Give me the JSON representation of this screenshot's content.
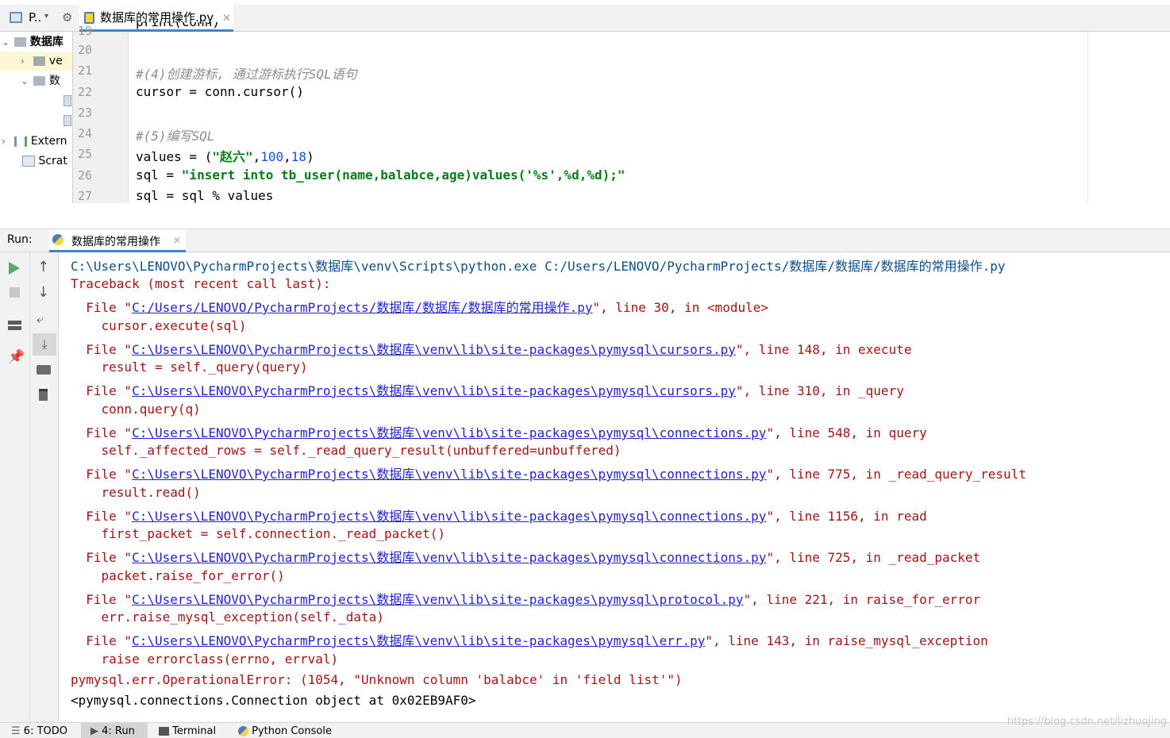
{
  "project": {
    "title": "P..",
    "tree": [
      {
        "label": "数据库",
        "level": 0
      },
      {
        "label": "ve",
        "level": 1
      },
      {
        "label": "数",
        "level": 1
      },
      {
        "label": "",
        "level": 2
      },
      {
        "label": "",
        "level": 2
      },
      {
        "label": "Extern",
        "level": 0
      },
      {
        "label": "Scrat",
        "level": 0
      }
    ]
  },
  "editor": {
    "tab_label": "数据库的常用操作.py",
    "line_numbers": [
      "19",
      "20",
      "21",
      "22",
      "23",
      "24",
      "25",
      "26",
      "27"
    ],
    "lines": {
      "l19": "print(conn)",
      "l21": "#(4)创建游标, 通过游标执行SQL语句",
      "l22": "cursor = conn.cursor()",
      "l24": "#(5)编写SQL",
      "l25_a": "values = (",
      "l25_s": "\"赵六\"",
      "l25_b": ",",
      "l25_n1": "100",
      "l25_c": ",",
      "l25_n2": "18",
      "l25_d": ")",
      "l26_a": "sql = ",
      "l26_s": "\"insert into tb_user(name,balabce,age)values('%s',%d,%d);\"",
      "l27": "sql = sql % values"
    }
  },
  "run": {
    "label": "Run:",
    "tab_label": "数据库的常用操作",
    "console": {
      "cmd": "C:\\Users\\LENOVO\\PycharmProjects\\数据库\\venv\\Scripts\\python.exe C:/Users/LENOVO/PycharmProjects/数据库/数据库/数据库的常用操作.py",
      "traceback": "Traceback (most recent call last):",
      "frames": [
        {
          "prefix": "  File \"",
          "link": "C:/Users/LENOVO/PycharmProjects/数据库/数据库/数据库的常用操作.py",
          "suffix": "\", line 30, in <module>",
          "code": "    cursor.execute(sql)"
        },
        {
          "prefix": "  File \"",
          "link": "C:\\Users\\LENOVO\\PycharmProjects\\数据库\\venv\\lib\\site-packages\\pymysql\\cursors.py",
          "suffix": "\", line 148, in execute",
          "code": "    result = self._query(query)"
        },
        {
          "prefix": "  File \"",
          "link": "C:\\Users\\LENOVO\\PycharmProjects\\数据库\\venv\\lib\\site-packages\\pymysql\\cursors.py",
          "suffix": "\", line 310, in _query",
          "code": "    conn.query(q)"
        },
        {
          "prefix": "  File \"",
          "link": "C:\\Users\\LENOVO\\PycharmProjects\\数据库\\venv\\lib\\site-packages\\pymysql\\connections.py",
          "suffix": "\", line 548, in query",
          "code": "    self._affected_rows = self._read_query_result(unbuffered=unbuffered)"
        },
        {
          "prefix": "  File \"",
          "link": "C:\\Users\\LENOVO\\PycharmProjects\\数据库\\venv\\lib\\site-packages\\pymysql\\connections.py",
          "suffix": "\", line 775, in _read_query_result",
          "code": "    result.read()"
        },
        {
          "prefix": "  File \"",
          "link": "C:\\Users\\LENOVO\\PycharmProjects\\数据库\\venv\\lib\\site-packages\\pymysql\\connections.py",
          "suffix": "\", line 1156, in read",
          "code": "    first_packet = self.connection._read_packet()"
        },
        {
          "prefix": "  File \"",
          "link": "C:\\Users\\LENOVO\\PycharmProjects\\数据库\\venv\\lib\\site-packages\\pymysql\\connections.py",
          "suffix": "\", line 725, in _read_packet",
          "code": "    packet.raise_for_error()"
        },
        {
          "prefix": "  File \"",
          "link": "C:\\Users\\LENOVO\\PycharmProjects\\数据库\\venv\\lib\\site-packages\\pymysql\\protocol.py",
          "suffix": "\", line 221, in raise_for_error",
          "code": "    err.raise_mysql_exception(self._data)"
        },
        {
          "prefix": "  File \"",
          "link": "C:\\Users\\LENOVO\\PycharmProjects\\数据库\\venv\\lib\\site-packages\\pymysql\\err.py",
          "suffix": "\", line 143, in raise_mysql_exception",
          "code": "    raise errorclass(errno, errval)"
        }
      ],
      "error": "pymysql.err.OperationalError: (1054, \"Unknown column 'balabce' in 'field list'\")",
      "tail": "<pymysql.connections.Connection object at 0x02EB9AF0>"
    }
  },
  "bottom_bar": {
    "todo": "6: TODO",
    "run": "4: Run",
    "terminal": "Terminal",
    "python_console": "Python Console"
  },
  "watermark": "https://blog.csdn.net/lizhuojing",
  "colors": {
    "accent": "#4083c9",
    "run_green": "#59a869",
    "error_red": "#a31515",
    "link_blue": "#2424cc"
  }
}
